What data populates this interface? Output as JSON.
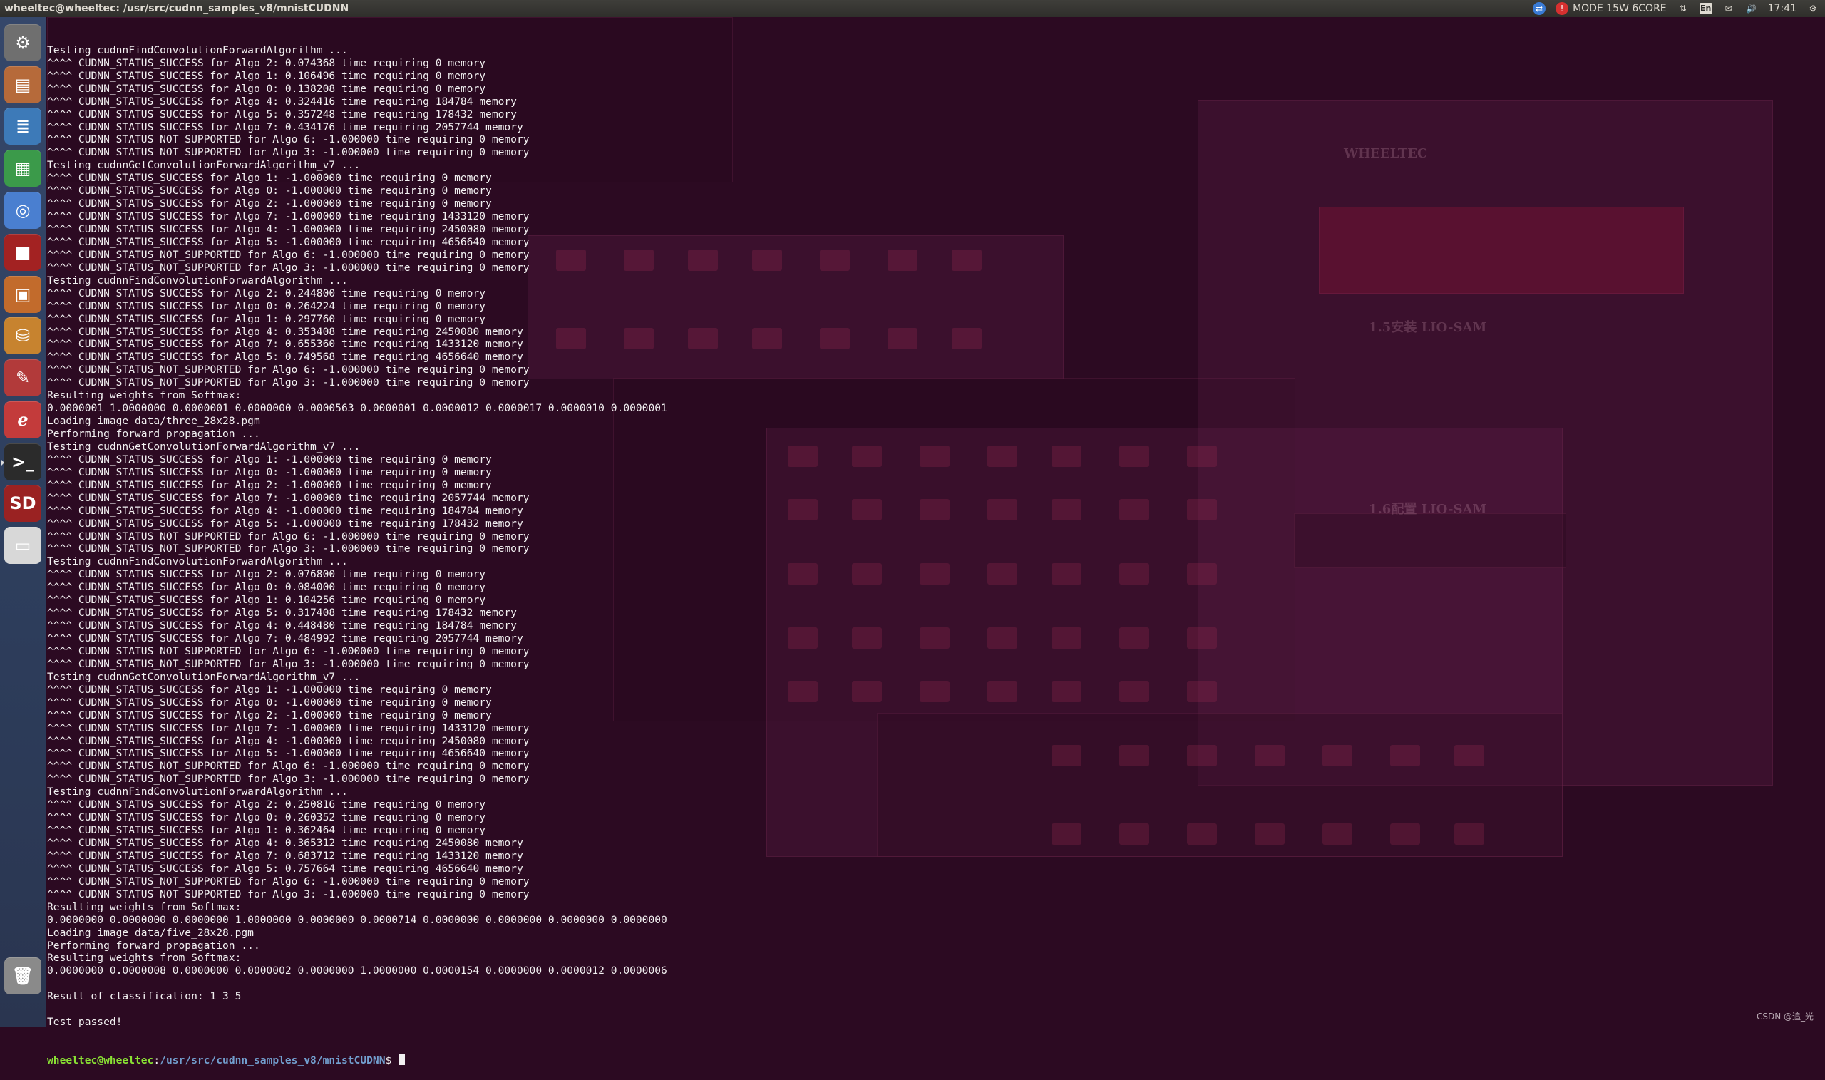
{
  "top_bar": {
    "window_title": "wheeltec@wheeltec: /usr/src/cudnn_samples_v8/mnistCUDNN",
    "mode_text": "MODE 15W 6CORE",
    "lang": "En",
    "clock": "17:41"
  },
  "launcher": {
    "items": [
      {
        "name": "system-settings-icon",
        "color": "#6f6f6f",
        "glyph": "⚙"
      },
      {
        "name": "files-icon",
        "color": "#b66a3a",
        "glyph": "▤"
      },
      {
        "name": "writer-icon",
        "color": "#3d7ab8",
        "glyph": "≣"
      },
      {
        "name": "calc-icon",
        "color": "#3b9a4a",
        "glyph": "▦"
      },
      {
        "name": "chromium-icon",
        "color": "#4a7fd0",
        "glyph": "◎"
      },
      {
        "name": "terminal-red-icon",
        "color": "#a32222",
        "glyph": "■"
      },
      {
        "name": "impress-icon",
        "color": "#c26b2c",
        "glyph": "▣"
      },
      {
        "name": "software-center-icon",
        "color": "#c7832f",
        "glyph": "⛁"
      },
      {
        "name": "tools-icon",
        "color": "#b23a3a",
        "glyph": "✎"
      },
      {
        "name": "text-editor-icon",
        "color": "#c33b3b",
        "glyph": "ℯ"
      },
      {
        "name": "terminal-icon",
        "color": "#2b2b2b",
        "glyph": ">_",
        "active": true
      },
      {
        "name": "sd-card-icon",
        "color": "#9a2222",
        "glyph": "SD"
      },
      {
        "name": "drive-icon",
        "color": "#d8d8d8",
        "glyph": "▭"
      },
      {
        "name": "trash-icon",
        "color": "#8a8a8a",
        "glyph": "🗑"
      }
    ]
  },
  "terminal": {
    "lines": [
      "Testing cudnnFindConvolutionForwardAlgorithm ...",
      "^^^^ CUDNN_STATUS_SUCCESS for Algo 2: 0.074368 time requiring 0 memory",
      "^^^^ CUDNN_STATUS_SUCCESS for Algo 1: 0.106496 time requiring 0 memory",
      "^^^^ CUDNN_STATUS_SUCCESS for Algo 0: 0.138208 time requiring 0 memory",
      "^^^^ CUDNN_STATUS_SUCCESS for Algo 4: 0.324416 time requiring 184784 memory",
      "^^^^ CUDNN_STATUS_SUCCESS for Algo 5: 0.357248 time requiring 178432 memory",
      "^^^^ CUDNN_STATUS_SUCCESS for Algo 7: 0.434176 time requiring 2057744 memory",
      "^^^^ CUDNN_STATUS_NOT_SUPPORTED for Algo 6: -1.000000 time requiring 0 memory",
      "^^^^ CUDNN_STATUS_NOT_SUPPORTED for Algo 3: -1.000000 time requiring 0 memory",
      "Testing cudnnGetConvolutionForwardAlgorithm_v7 ...",
      "^^^^ CUDNN_STATUS_SUCCESS for Algo 1: -1.000000 time requiring 0 memory",
      "^^^^ CUDNN_STATUS_SUCCESS for Algo 0: -1.000000 time requiring 0 memory",
      "^^^^ CUDNN_STATUS_SUCCESS for Algo 2: -1.000000 time requiring 0 memory",
      "^^^^ CUDNN_STATUS_SUCCESS for Algo 7: -1.000000 time requiring 1433120 memory",
      "^^^^ CUDNN_STATUS_SUCCESS for Algo 4: -1.000000 time requiring 2450080 memory",
      "^^^^ CUDNN_STATUS_SUCCESS for Algo 5: -1.000000 time requiring 4656640 memory",
      "^^^^ CUDNN_STATUS_NOT_SUPPORTED for Algo 6: -1.000000 time requiring 0 memory",
      "^^^^ CUDNN_STATUS_NOT_SUPPORTED for Algo 3: -1.000000 time requiring 0 memory",
      "Testing cudnnFindConvolutionForwardAlgorithm ...",
      "^^^^ CUDNN_STATUS_SUCCESS for Algo 2: 0.244800 time requiring 0 memory",
      "^^^^ CUDNN_STATUS_SUCCESS for Algo 0: 0.264224 time requiring 0 memory",
      "^^^^ CUDNN_STATUS_SUCCESS for Algo 1: 0.297760 time requiring 0 memory",
      "^^^^ CUDNN_STATUS_SUCCESS for Algo 4: 0.353408 time requiring 2450080 memory",
      "^^^^ CUDNN_STATUS_SUCCESS for Algo 7: 0.655360 time requiring 1433120 memory",
      "^^^^ CUDNN_STATUS_SUCCESS for Algo 5: 0.749568 time requiring 4656640 memory",
      "^^^^ CUDNN_STATUS_NOT_SUPPORTED for Algo 6: -1.000000 time requiring 0 memory",
      "^^^^ CUDNN_STATUS_NOT_SUPPORTED for Algo 3: -1.000000 time requiring 0 memory",
      "Resulting weights from Softmax:",
      "0.0000001 1.0000000 0.0000001 0.0000000 0.0000563 0.0000001 0.0000012 0.0000017 0.0000010 0.0000001",
      "Loading image data/three_28x28.pgm",
      "Performing forward propagation ...",
      "Testing cudnnGetConvolutionForwardAlgorithm_v7 ...",
      "^^^^ CUDNN_STATUS_SUCCESS for Algo 1: -1.000000 time requiring 0 memory",
      "^^^^ CUDNN_STATUS_SUCCESS for Algo 0: -1.000000 time requiring 0 memory",
      "^^^^ CUDNN_STATUS_SUCCESS for Algo 2: -1.000000 time requiring 0 memory",
      "^^^^ CUDNN_STATUS_SUCCESS for Algo 7: -1.000000 time requiring 2057744 memory",
      "^^^^ CUDNN_STATUS_SUCCESS for Algo 4: -1.000000 time requiring 184784 memory",
      "^^^^ CUDNN_STATUS_SUCCESS for Algo 5: -1.000000 time requiring 178432 memory",
      "^^^^ CUDNN_STATUS_NOT_SUPPORTED for Algo 6: -1.000000 time requiring 0 memory",
      "^^^^ CUDNN_STATUS_NOT_SUPPORTED for Algo 3: -1.000000 time requiring 0 memory",
      "Testing cudnnFindConvolutionForwardAlgorithm ...",
      "^^^^ CUDNN_STATUS_SUCCESS for Algo 2: 0.076800 time requiring 0 memory",
      "^^^^ CUDNN_STATUS_SUCCESS for Algo 0: 0.084000 time requiring 0 memory",
      "^^^^ CUDNN_STATUS_SUCCESS for Algo 1: 0.104256 time requiring 0 memory",
      "^^^^ CUDNN_STATUS_SUCCESS for Algo 5: 0.317408 time requiring 178432 memory",
      "^^^^ CUDNN_STATUS_SUCCESS for Algo 4: 0.448480 time requiring 184784 memory",
      "^^^^ CUDNN_STATUS_SUCCESS for Algo 7: 0.484992 time requiring 2057744 memory",
      "^^^^ CUDNN_STATUS_NOT_SUPPORTED for Algo 6: -1.000000 time requiring 0 memory",
      "^^^^ CUDNN_STATUS_NOT_SUPPORTED for Algo 3: -1.000000 time requiring 0 memory",
      "Testing cudnnGetConvolutionForwardAlgorithm_v7 ...",
      "^^^^ CUDNN_STATUS_SUCCESS for Algo 1: -1.000000 time requiring 0 memory",
      "^^^^ CUDNN_STATUS_SUCCESS for Algo 0: -1.000000 time requiring 0 memory",
      "^^^^ CUDNN_STATUS_SUCCESS for Algo 2: -1.000000 time requiring 0 memory",
      "^^^^ CUDNN_STATUS_SUCCESS for Algo 7: -1.000000 time requiring 1433120 memory",
      "^^^^ CUDNN_STATUS_SUCCESS for Algo 4: -1.000000 time requiring 2450080 memory",
      "^^^^ CUDNN_STATUS_SUCCESS for Algo 5: -1.000000 time requiring 4656640 memory",
      "^^^^ CUDNN_STATUS_NOT_SUPPORTED for Algo 6: -1.000000 time requiring 0 memory",
      "^^^^ CUDNN_STATUS_NOT_SUPPORTED for Algo 3: -1.000000 time requiring 0 memory",
      "Testing cudnnFindConvolutionForwardAlgorithm ...",
      "^^^^ CUDNN_STATUS_SUCCESS for Algo 2: 0.250816 time requiring 0 memory",
      "^^^^ CUDNN_STATUS_SUCCESS for Algo 0: 0.260352 time requiring 0 memory",
      "^^^^ CUDNN_STATUS_SUCCESS for Algo 1: 0.362464 time requiring 0 memory",
      "^^^^ CUDNN_STATUS_SUCCESS for Algo 4: 0.365312 time requiring 2450080 memory",
      "^^^^ CUDNN_STATUS_SUCCESS for Algo 7: 0.683712 time requiring 1433120 memory",
      "^^^^ CUDNN_STATUS_SUCCESS for Algo 5: 0.757664 time requiring 4656640 memory",
      "^^^^ CUDNN_STATUS_NOT_SUPPORTED for Algo 6: -1.000000 time requiring 0 memory",
      "^^^^ CUDNN_STATUS_NOT_SUPPORTED for Algo 3: -1.000000 time requiring 0 memory",
      "Resulting weights from Softmax:",
      "0.0000000 0.0000000 0.0000000 1.0000000 0.0000000 0.0000714 0.0000000 0.0000000 0.0000000 0.0000000",
      "Loading image data/five_28x28.pgm",
      "Performing forward propagation ...",
      "Resulting weights from Softmax:",
      "0.0000000 0.0000008 0.0000000 0.0000002 0.0000000 1.0000000 0.0000154 0.0000000 0.0000012 0.0000006",
      "",
      "Result of classification: 1 3 5",
      "",
      "Test passed!"
    ],
    "prompt_user": "wheeltec@wheeltec",
    "prompt_sep": ":",
    "prompt_path": "/usr/src/cudnn_samples_v8/mnistCUDNN",
    "prompt_end": "$ "
  },
  "background": {
    "ghost_logo": "WHEELTEC",
    "ghost_heading_1": "1.5安装 LIO-SAM",
    "ghost_heading_2": "1.6配置 LIO-SAM"
  },
  "watermark": "CSDN @追_光"
}
